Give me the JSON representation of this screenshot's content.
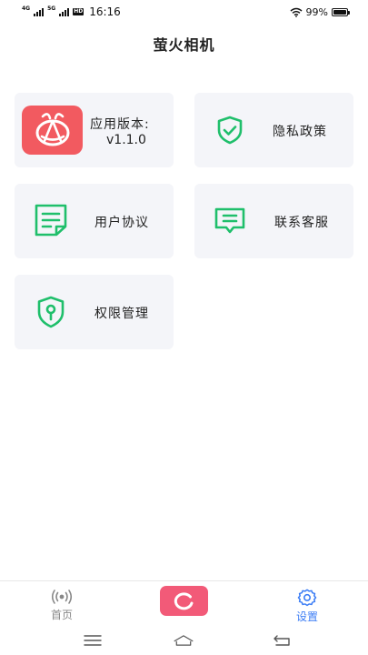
{
  "status_bar": {
    "network_1": "4G",
    "network_2": "5G",
    "hd": "HD",
    "time": "16:16",
    "battery": "99%",
    "battery_level": 0.99
  },
  "header": {
    "title": "萤火相机"
  },
  "cards": {
    "version": {
      "title": "应用版本:",
      "value": "v1.1.0",
      "icon": "app-logo-icon"
    },
    "privacy": {
      "label": "隐私政策",
      "icon": "shield-check-icon"
    },
    "agreement": {
      "label": "用户协议",
      "icon": "document-icon"
    },
    "contact": {
      "label": "联系客服",
      "icon": "chat-icon"
    },
    "permissions": {
      "label": "权限管理",
      "icon": "shield-key-icon"
    }
  },
  "bottom_nav": {
    "home": {
      "label": "首页",
      "icon": "broadcast-icon"
    },
    "camera": {
      "icon": "camera-ring-icon"
    },
    "settings": {
      "label": "设置",
      "icon": "gear-icon"
    }
  },
  "colors": {
    "accent_green": "#1fbf6b",
    "brand_red": "#f25a60",
    "camera_pink": "#f25a78",
    "active_blue": "#3d7ef5",
    "card_bg": "#f4f5f9"
  }
}
